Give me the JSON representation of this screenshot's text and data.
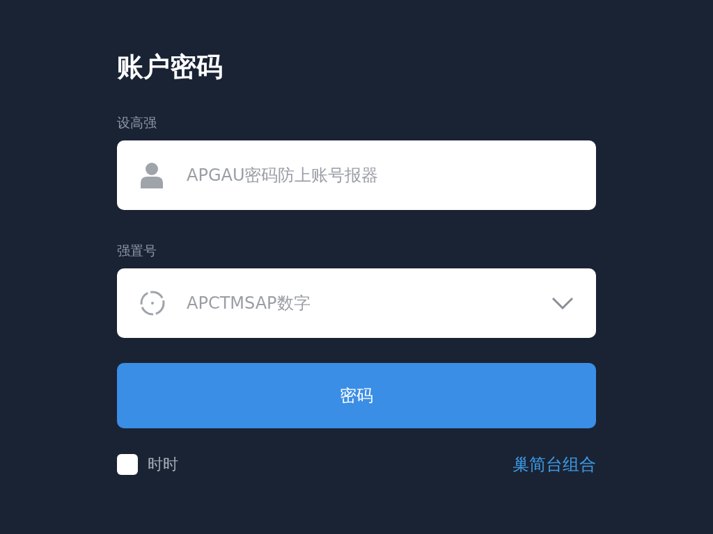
{
  "title": "账户密码",
  "fields": [
    {
      "kind": "text",
      "label": "设高强",
      "placeholder": "APGAU密码防上账号报器"
    },
    {
      "kind": "select",
      "label": "强置号",
      "placeholder": "APCTMSAP数字"
    }
  ],
  "submit": {
    "label": "密码"
  },
  "remember": {
    "label": "时时",
    "checked": false
  },
  "link": {
    "label": "巢简台组合"
  }
}
